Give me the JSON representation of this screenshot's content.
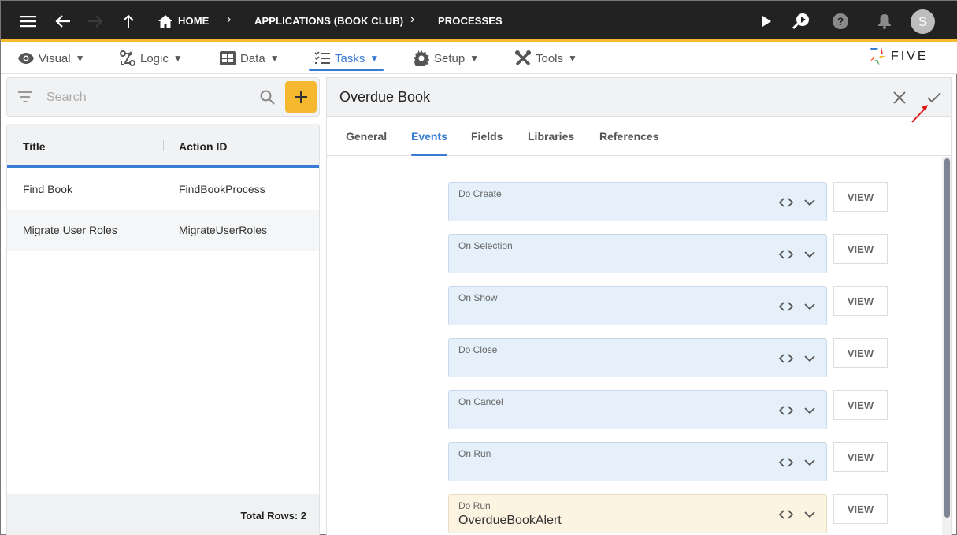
{
  "topbar": {
    "breadcrumbs": [
      "HOME",
      "APPLICATIONS (BOOK CLUB)",
      "PROCESSES"
    ],
    "avatar_initial": "S",
    "icons": [
      "menu-icon",
      "back-arrow-icon",
      "forward-arrow-icon",
      "up-arrow-icon",
      "home-icon",
      "play-icon",
      "search-play-icon",
      "help-icon",
      "bell-icon"
    ]
  },
  "menubar": {
    "items": [
      {
        "label": "Visual",
        "icon": "eye-icon"
      },
      {
        "label": "Logic",
        "icon": "logic-icon"
      },
      {
        "label": "Data",
        "icon": "table-icon"
      },
      {
        "label": "Tasks",
        "icon": "checklist-icon",
        "active": true
      },
      {
        "label": "Setup",
        "icon": "gear-icon"
      },
      {
        "label": "Tools",
        "icon": "tools-icon"
      }
    ],
    "caret": "▼",
    "logo_text": "FIVE"
  },
  "left": {
    "search_placeholder": "Search",
    "columns": [
      "Title",
      "Action ID"
    ],
    "rows": [
      {
        "title": "Find Book",
        "action_id": "FindBookProcess"
      },
      {
        "title": "Migrate User Roles",
        "action_id": "MigrateUserRoles"
      }
    ],
    "total_rows": "Total Rows: 2"
  },
  "right": {
    "title": "Overdue Book",
    "tabs": [
      "General",
      "Events",
      "Fields",
      "Libraries",
      "References"
    ],
    "active_tab": "Events",
    "view_label": "VIEW",
    "events": [
      {
        "label": "Do Create",
        "value": ""
      },
      {
        "label": "On Selection",
        "value": ""
      },
      {
        "label": "On Show",
        "value": ""
      },
      {
        "label": "Do Close",
        "value": ""
      },
      {
        "label": "On Cancel",
        "value": ""
      },
      {
        "label": "On Run",
        "value": ""
      },
      {
        "label": "Do Run",
        "value": "OverdueBookAlert"
      }
    ]
  },
  "colors": {
    "accent": "#3a7bd5",
    "brand_yellow": "#f5b82e",
    "topbar": "#222222",
    "field_empty": "#e6f0fb",
    "field_filled": "#fdf3e1"
  }
}
